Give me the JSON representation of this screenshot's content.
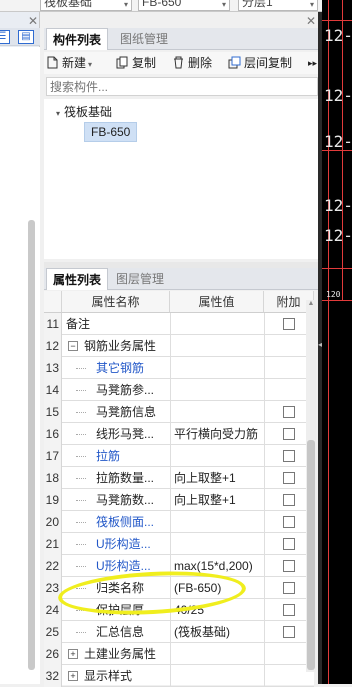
{
  "top_combos": [
    {
      "label": "筏板基础"
    },
    {
      "label": "FB-650"
    },
    {
      "label": "分层1"
    }
  ],
  "component_panel": {
    "tabs": [
      "构件列表",
      "图纸管理"
    ],
    "toolbar": {
      "new": "新建",
      "copy": "复制",
      "delete": "删除",
      "floor_copy": "层间复制",
      "more": "▸▸"
    },
    "search_placeholder": "搜索构件...",
    "tree": {
      "root": "筏板基础",
      "selected": "FB-650"
    }
  },
  "property_panel": {
    "tabs": [
      "属性列表",
      "图层管理"
    ],
    "headers": {
      "name": "属性名称",
      "value": "属性值",
      "extra": "附加"
    },
    "rows": [
      {
        "num": "11",
        "name": "备注",
        "value": "",
        "check": true,
        "level": 0,
        "blue": false,
        "toggle": ""
      },
      {
        "num": "12",
        "name": "钢筋业务属性",
        "value": "",
        "check": false,
        "level": 0,
        "blue": false,
        "toggle": "−"
      },
      {
        "num": "13",
        "name": "其它钢筋",
        "value": "",
        "check": false,
        "level": 1,
        "blue": true,
        "toggle": ""
      },
      {
        "num": "14",
        "name": "马凳筋参...",
        "value": "",
        "check": false,
        "level": 1,
        "blue": false,
        "toggle": ""
      },
      {
        "num": "15",
        "name": "马凳筋信息",
        "value": "",
        "check": true,
        "level": 1,
        "blue": false,
        "toggle": ""
      },
      {
        "num": "16",
        "name": "线形马凳...",
        "value": "平行横向受力筋",
        "check": true,
        "level": 1,
        "blue": false,
        "toggle": ""
      },
      {
        "num": "17",
        "name": "拉筋",
        "value": "",
        "check": true,
        "level": 1,
        "blue": true,
        "toggle": ""
      },
      {
        "num": "18",
        "name": "拉筋数量...",
        "value": "向上取整+1",
        "check": true,
        "level": 1,
        "blue": false,
        "toggle": ""
      },
      {
        "num": "19",
        "name": "马凳筋数...",
        "value": "向上取整+1",
        "check": true,
        "level": 1,
        "blue": false,
        "toggle": ""
      },
      {
        "num": "20",
        "name": "筏板侧面...",
        "value": "",
        "check": true,
        "level": 1,
        "blue": true,
        "toggle": ""
      },
      {
        "num": "21",
        "name": "U形构造...",
        "value": "",
        "check": true,
        "level": 1,
        "blue": true,
        "toggle": ""
      },
      {
        "num": "22",
        "name": "U形构造...",
        "value": "max(15*d,200)",
        "check": true,
        "level": 1,
        "blue": true,
        "toggle": ""
      },
      {
        "num": "23",
        "name": "归类名称",
        "value": "(FB-650)",
        "check": true,
        "level": 1,
        "blue": false,
        "toggle": ""
      },
      {
        "num": "24",
        "name": "保护层厚...",
        "value": "40/25",
        "check": true,
        "level": 1,
        "blue": false,
        "toggle": ""
      },
      {
        "num": "25",
        "name": "汇总信息",
        "value": "(筏板基础)",
        "check": true,
        "level": 1,
        "blue": false,
        "toggle": ""
      },
      {
        "num": "26",
        "name": "土建业务属性",
        "value": "",
        "check": false,
        "level": 0,
        "blue": false,
        "toggle": "+"
      },
      {
        "num": "32",
        "name": "显示样式",
        "value": "",
        "check": false,
        "level": 0,
        "blue": false,
        "toggle": "+"
      }
    ]
  },
  "drawing": {
    "labels": [
      "12-",
      "12-0",
      "12-A",
      "12-A",
      "12-",
      "120"
    ]
  },
  "colors": {
    "highlight": "#f0ee1e",
    "link_blue": "#2358c8",
    "selected_bg": "#cfe0f5",
    "accent": "#2f6bd1"
  }
}
